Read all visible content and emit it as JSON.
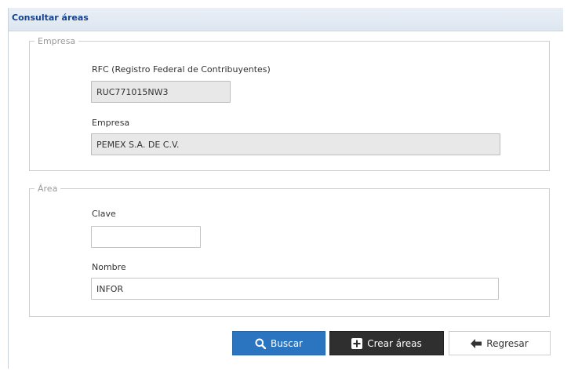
{
  "panel": {
    "title": "Consultar áreas"
  },
  "empresa_group": {
    "legend": "Empresa",
    "rfc": {
      "label": "RFC (Registro Federal de Contribuyentes)",
      "value": "RUC771015NW3"
    },
    "empresa": {
      "label": "Empresa",
      "value": "PEMEX S.A. DE C.V."
    }
  },
  "area_group": {
    "legend": "Área",
    "clave": {
      "label": "Clave",
      "value": ""
    },
    "nombre": {
      "label": "Nombre",
      "value": "INFOR"
    }
  },
  "buttons": {
    "search": {
      "label": "Buscar",
      "icon": "search-icon"
    },
    "create": {
      "label": "Crear áreas",
      "icon": "plus-square-icon"
    },
    "back": {
      "label": "Regresar",
      "icon": "arrow-left-icon"
    }
  },
  "colors": {
    "header_text": "#15428b",
    "search_button": "#2b75c0",
    "create_button": "#2f2f2f"
  }
}
